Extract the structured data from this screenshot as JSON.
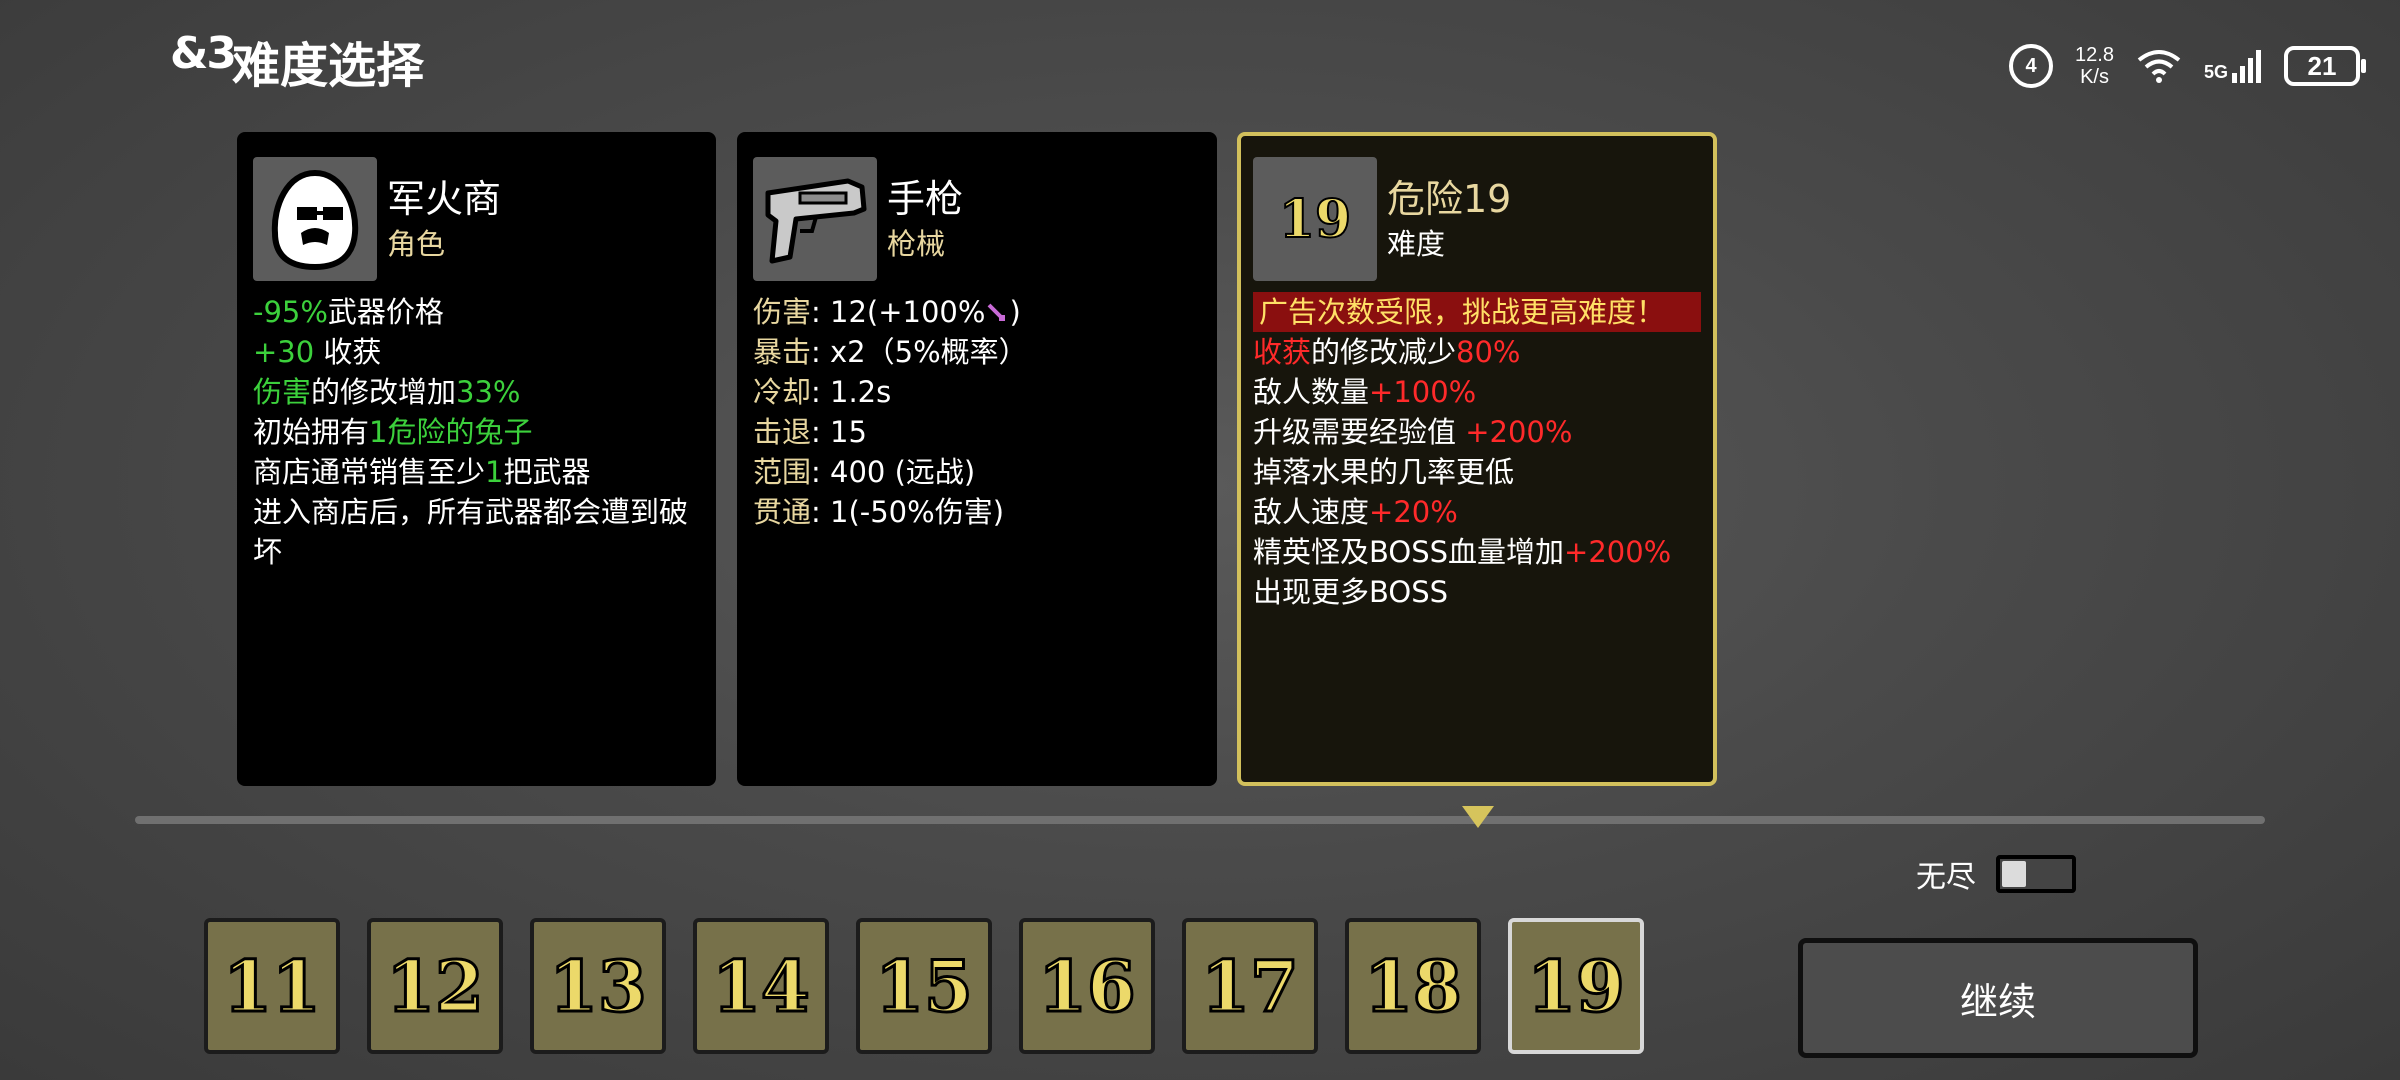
{
  "header": {
    "back_label": "&3",
    "title": "难度选择"
  },
  "status_bar": {
    "hd": "4",
    "speed_value": "12.8",
    "speed_unit": "K/s",
    "network": "5G",
    "battery": "21"
  },
  "cards": {
    "character": {
      "name": "军火商",
      "type": "角色",
      "icon": "bald-egg-face-with-glasses-icon",
      "lines": [
        {
          "highlight": "-95%",
          "text": "武器价格"
        },
        {
          "highlight": "+30",
          "text": " 收获"
        },
        {
          "highlight": "伤害",
          "text": "的修改增加",
          "highlight2": "33%"
        },
        {
          "text": "初始拥有",
          "highlight": "1危险的兔子"
        },
        {
          "text": "商店通常销售至少",
          "highlight": "1",
          "text2": "把武器"
        },
        {
          "text": "进入商店后，所有武器都会遭到破坏"
        }
      ]
    },
    "weapon": {
      "name": "手枪",
      "type": "枪械",
      "icon": "pistol-icon",
      "lines": [
        {
          "label": "伤害",
          "value": ": 12(+100%",
          "suffix": ")"
        },
        {
          "label": "暴击",
          "value": ": x2（5%概率）"
        },
        {
          "label": "冷却",
          "value": ": 1.2s"
        },
        {
          "label": "击退",
          "value": ": 15"
        },
        {
          "label": "范围",
          "value": ": 400 (远战)"
        },
        {
          "label": "贯通",
          "value": ": 1(-50%伤害)"
        }
      ]
    },
    "difficulty": {
      "badge": "19",
      "name": "危险19",
      "type": "难度",
      "warning": "广告次数受限，挑战更高难度！",
      "lines": [
        {
          "highlight": "收获",
          "text": "的修改减少",
          "highlight2": "80%"
        },
        {
          "text": "敌人数量",
          "highlight": "+100%"
        },
        {
          "text": "升级需要经验值 ",
          "highlight": "+200%"
        },
        {
          "text": "掉落水果的几率更低"
        },
        {
          "text": "敌人速度",
          "highlight": "+20%"
        },
        {
          "text": "精英怪及BOSS血量增加",
          "highlight": "+200%"
        },
        {
          "text": "出现更多BOSS"
        }
      ]
    }
  },
  "difficulty_levels": [
    "11",
    "12",
    "13",
    "14",
    "15",
    "16",
    "17",
    "18",
    "19"
  ],
  "selected_level": "19",
  "endless": {
    "label": "无尽",
    "enabled": false
  },
  "continue_label": "继续",
  "colors": {
    "positive": "#3cd13c",
    "negative": "#ff2a2a",
    "accent": "#d2c05c",
    "tile": "#77714a"
  }
}
